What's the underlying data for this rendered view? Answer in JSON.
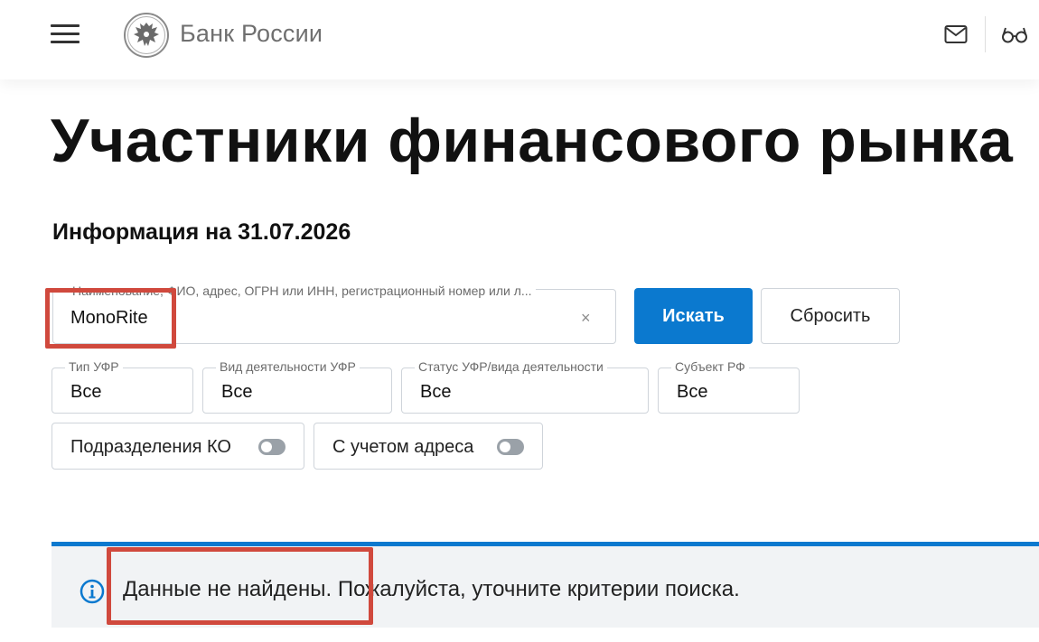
{
  "header": {
    "brand": "Банк России",
    "icons": [
      "menu-icon",
      "emblem-logo",
      "mail-icon",
      "glasses-icon"
    ]
  },
  "page": {
    "title": "Участники финансового рынка",
    "info_date": "Информация на 31.07.2026"
  },
  "search": {
    "placeholder": "Наименование, ФИО, адрес, ОГРН или ИНН, регистрационный номер или л...",
    "value": "MonoRite",
    "clear_label": "×",
    "search_button": "Искать",
    "reset_button": "Сбросить"
  },
  "filters": [
    {
      "label": "Тип УФР",
      "value": "Все"
    },
    {
      "label": "Вид деятельности УФР",
      "value": "Все"
    },
    {
      "label": "Статус УФР/вида деятельности",
      "value": "Все"
    },
    {
      "label": "Субъект РФ",
      "value": "Все"
    }
  ],
  "toggles": [
    {
      "label": "Подразделения КО",
      "on": false
    },
    {
      "label": "С учетом адреса",
      "on": false
    }
  ],
  "result": {
    "message": "Данные не найдены. Пожалуйста, уточните критерии поиска."
  },
  "colors": {
    "accent": "#0b79cf",
    "highlight": "#d0493d",
    "notice_bg": "#f1f3f5"
  }
}
